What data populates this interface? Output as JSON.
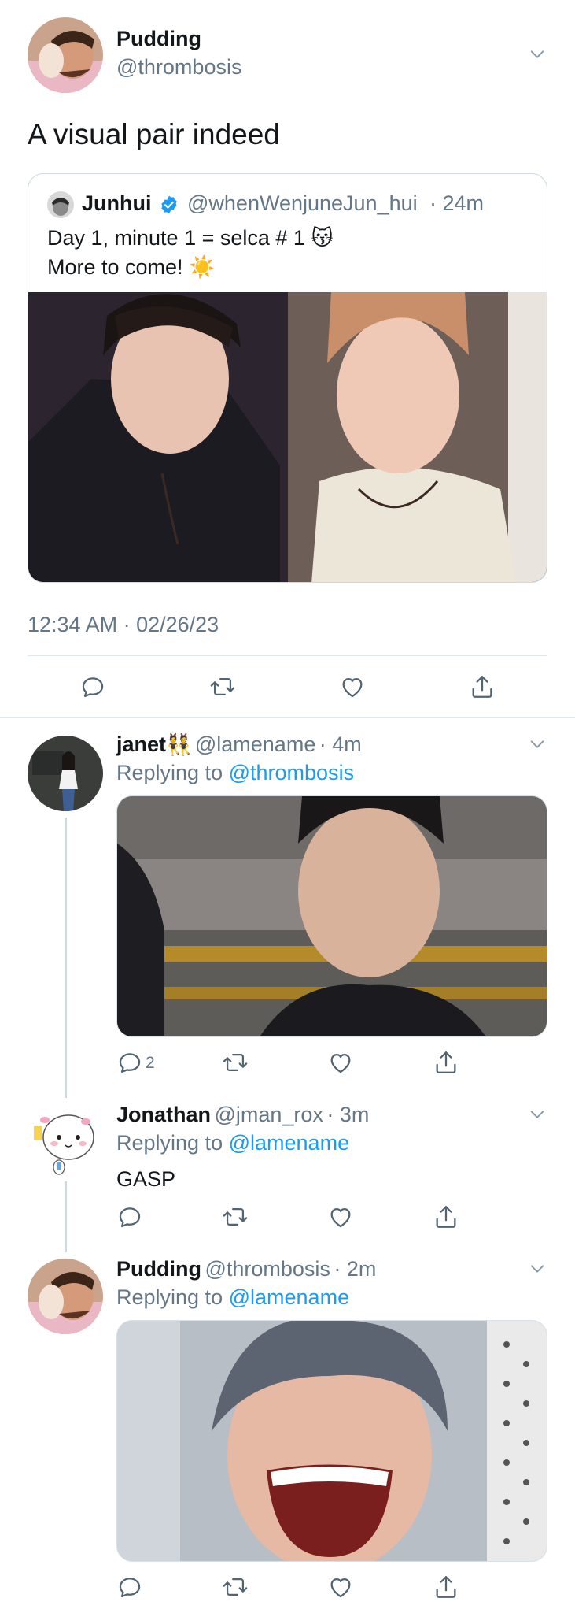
{
  "main_tweet": {
    "display_name": "Pudding",
    "handle": "@thrombosis",
    "text": "A visual pair indeed",
    "timestamp": "12:34 AM · 02/26/23"
  },
  "quoted_tweet": {
    "display_name": "Junhui",
    "verified": true,
    "handle": "@whenWenjuneJun_hui",
    "time": "· 24m",
    "line1": "Day 1, minute 1 = selca # 1",
    "line1_emoji": "😽",
    "line2": "More to come!",
    "line2_emoji": "☀️"
  },
  "replies": [
    {
      "display_name": "janet",
      "name_emoji": "👯",
      "handle": "@lamename",
      "time": "· 4m",
      "replying_prefix": "Replying to",
      "replying_to": "@thrombosis",
      "reply_count": "2"
    },
    {
      "display_name": "Jonathan",
      "handle": "@jman_rox",
      "time": "· 3m",
      "replying_prefix": "Replying to",
      "replying_to": "@lamename",
      "text": "GASP"
    },
    {
      "display_name": "Pudding",
      "handle": "@thrombosis",
      "time": "· 2m",
      "replying_prefix": "Replying to",
      "replying_to": "@lamename"
    }
  ],
  "icons": {
    "reply": "reply-icon",
    "retweet": "retweet-icon",
    "like": "heart-icon",
    "share": "share-icon",
    "more": "chevron-down-icon",
    "verified": "verified-badge-icon"
  },
  "colors": {
    "link": "#1d9bf0",
    "secondary_text": "#657786",
    "divider": "#e1e8ed",
    "thread_line": "#cfd9de"
  }
}
